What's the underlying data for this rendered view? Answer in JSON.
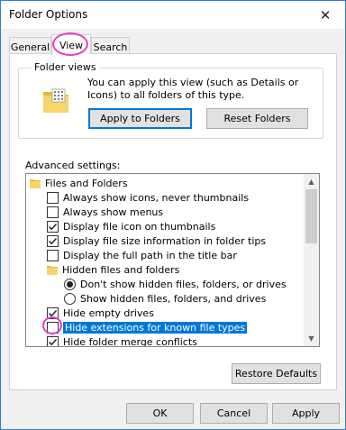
{
  "window": {
    "title": "Folder Options"
  },
  "tabs": [
    {
      "label": "General"
    },
    {
      "label": "View"
    },
    {
      "label": "Search"
    }
  ],
  "folder_views": {
    "label": "Folder views",
    "description": "You can apply this view (such as Details or Icons) to all folders of this type.",
    "apply_button": "Apply to Folders",
    "reset_button": "Reset Folders"
  },
  "advanced": {
    "label": "Advanced settings:",
    "items": [
      {
        "label": "Files and Folders",
        "kind": "folder",
        "checked": null
      },
      {
        "label": "Always show icons, never thumbnails",
        "kind": "checkbox",
        "checked": false
      },
      {
        "label": "Always show menus",
        "kind": "checkbox",
        "checked": false
      },
      {
        "label": "Display file icon on thumbnails",
        "kind": "checkbox",
        "checked": true
      },
      {
        "label": "Display file size information in folder tips",
        "kind": "checkbox",
        "checked": true
      },
      {
        "label": "Display the full path in the title bar",
        "kind": "checkbox",
        "checked": false
      },
      {
        "label": "Hidden files and folders",
        "kind": "folder",
        "checked": null
      },
      {
        "label": "Don't show hidden files, folders, or drives",
        "kind": "radio",
        "checked": true
      },
      {
        "label": "Show hidden files, folders, and drives",
        "kind": "radio",
        "checked": false
      },
      {
        "label": "Hide empty drives",
        "kind": "checkbox",
        "checked": true
      },
      {
        "label": "Hide extensions for known file types",
        "kind": "checkbox",
        "checked": false
      },
      {
        "label": "Hide folder merge conflicts",
        "kind": "checkbox",
        "checked": true
      }
    ]
  },
  "restore_button": "Restore Defaults",
  "footer": {
    "ok": "OK",
    "cancel": "Cancel",
    "apply": "Apply"
  },
  "colors": {
    "accent": "#0078d7",
    "highlight": "#e040c8",
    "folder": "#f4c63d"
  }
}
